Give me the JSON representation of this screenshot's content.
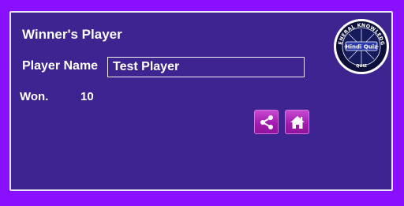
{
  "panel": {
    "title": "Winner's Player",
    "player_name_label": "Player Name",
    "player_name_value": "Test Player",
    "won_label": "Won.",
    "won_value": "10"
  },
  "logo": {
    "top_text": "GENERAL KNOWLEDGE",
    "center_text": "Hindi Quiz",
    "bottom_text": "QUIZ"
  },
  "icons": {
    "share": "share-icon",
    "home": "home-icon"
  },
  "colors": {
    "outer_bg": "#8b0fff",
    "panel_bg": "#3d2490",
    "button": "#b12abd"
  }
}
